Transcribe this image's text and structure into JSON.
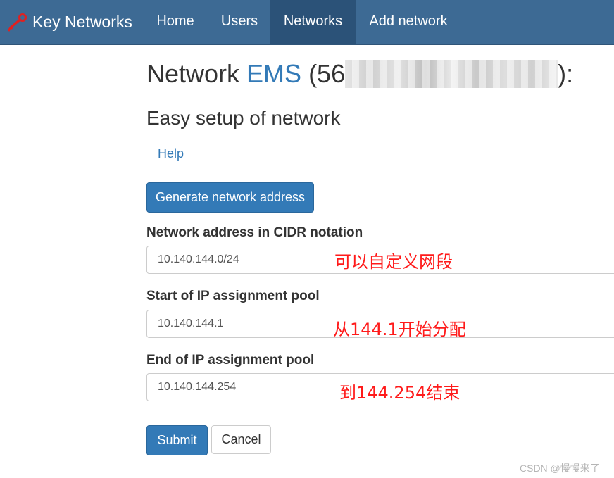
{
  "nav": {
    "brand": "Key Networks",
    "items": [
      "Home",
      "Users",
      "Networks",
      "Add network"
    ],
    "active": "Networks"
  },
  "page": {
    "title_prefix": "Network ",
    "network_name": "EMS",
    "title_id_visible": "(56",
    "title_suffix": "):",
    "subtitle": "Easy setup of network",
    "help_link": "Help",
    "generate_button": "Generate network address"
  },
  "form": {
    "cidr_label": "Network address in CIDR notation",
    "cidr_value": "10.140.144.0/24",
    "pool_start_label": "Start of IP assignment pool",
    "pool_start_value": "10.140.144.1",
    "pool_end_label": "End of IP assignment pool",
    "pool_end_value": "10.140.144.254",
    "submit": "Submit",
    "cancel": "Cancel"
  },
  "annotations": {
    "cidr_note": "可以自定义网段",
    "start_note": "从144.1开始分配",
    "end_note": "到144.254结束"
  },
  "watermark": "CSDN @慢慢来了",
  "colors": {
    "navbar": "#3d6a94",
    "navbar_active": "#2b5278",
    "link": "#337ab7",
    "annotation": "#ff1a1a"
  },
  "icons": {
    "brand": "key-icon"
  }
}
